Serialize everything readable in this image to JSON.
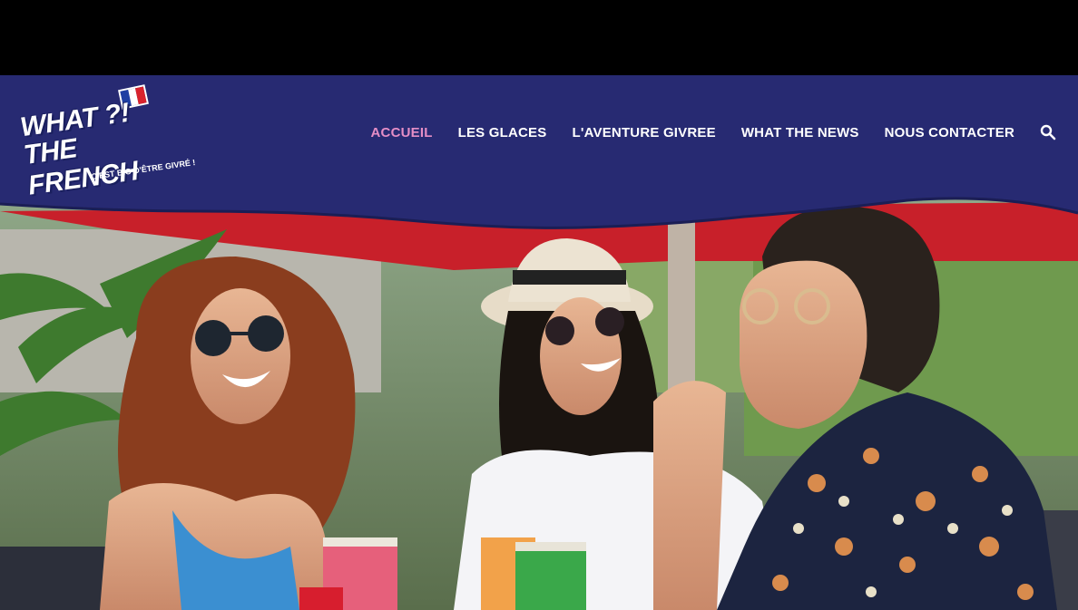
{
  "brand": {
    "name_line1": "WHAT ?!",
    "name_line2": "THE FRENCH",
    "tagline": "C'EST BIO D'ÊTRE GIVRÉ !"
  },
  "nav": {
    "items": [
      {
        "label": "ACCUEIL",
        "active": true
      },
      {
        "label": "LES GLACES",
        "active": false
      },
      {
        "label": "L'AVENTURE GIVREE",
        "active": false
      },
      {
        "label": "WHAT THE NEWS",
        "active": false
      },
      {
        "label": "NOUS CONTACTER",
        "active": false
      }
    ],
    "search_icon": "search-icon"
  },
  "colors": {
    "header_bg": "#272a72",
    "active_link": "#e58ec6",
    "link": "#ffffff",
    "awning_red": "#c8202a"
  },
  "hero": {
    "image": "photo of three friends laughing and eating ice cream at an outdoor café"
  }
}
